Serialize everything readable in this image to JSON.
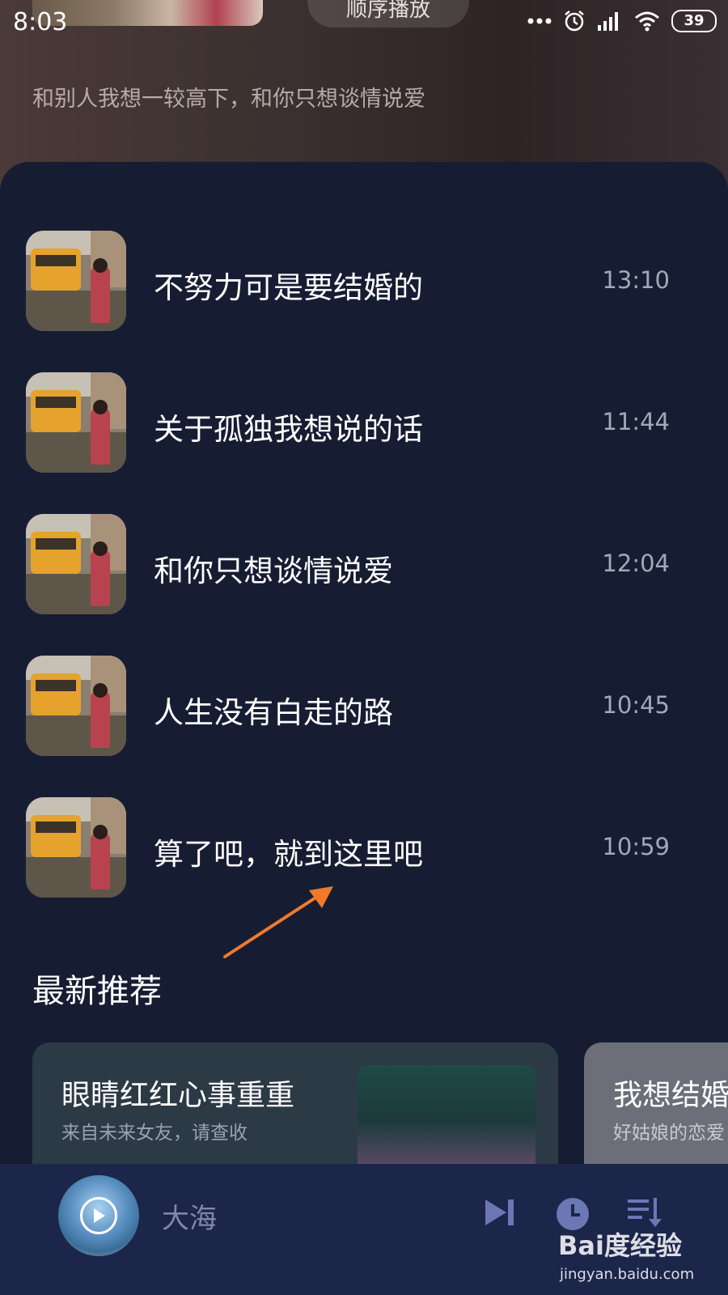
{
  "status_bar": {
    "time": "8:03",
    "battery": "39"
  },
  "header": {
    "play_mode_label": "顺序播放",
    "subtitle": "和别人我想一较高下，和你只想谈情说爱"
  },
  "songs": [
    {
      "title": "不努力可是要结婚的",
      "duration": "13:10"
    },
    {
      "title": "关于孤独我想说的话",
      "duration": "11:44"
    },
    {
      "title": "和你只想谈情说爱",
      "duration": "12:04"
    },
    {
      "title": "人生没有白走的路",
      "duration": "10:45"
    },
    {
      "title": "算了吧，就到这里吧",
      "duration": "10:59"
    }
  ],
  "recommend": {
    "title": "最新推荐",
    "cards": [
      {
        "title": "眼睛红红心事重重",
        "subtitle": "来自未来女友，请查收"
      },
      {
        "title": "我想结婚",
        "subtitle": "好姑娘的恋爱"
      }
    ]
  },
  "player": {
    "now_playing": "大海"
  },
  "watermark": {
    "brand": "Bai度经验",
    "url": "jingyan.baidu.com"
  },
  "colors": {
    "panel_bg": "#161d33",
    "player_bg": "#1c254a",
    "annotation_arrow": "#f07a2c",
    "control_icons": "#6b78b4"
  }
}
